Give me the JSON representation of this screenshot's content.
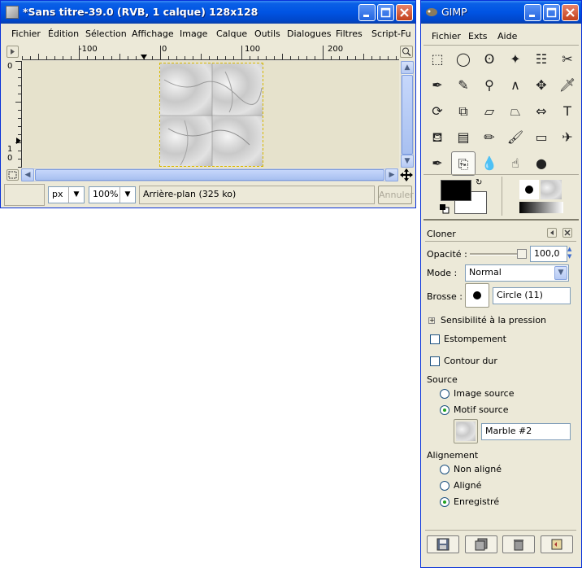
{
  "image_window": {
    "title": "*Sans titre-39.0 (RVB, 1 calque) 128x128",
    "menu": [
      "Fichier",
      "Édition",
      "Sélection",
      "Affichage",
      "Image",
      "Calque",
      "Outils",
      "Dialogues",
      "Filtres",
      "Script-Fu"
    ],
    "ruler_labels": [
      "-100",
      "0",
      "100",
      "200"
    ],
    "vruler_labels": [
      "0",
      "1",
      "0"
    ],
    "unit": "px",
    "zoom": "100%",
    "status": "Arrière-plan (325 ko)",
    "cancel_label": "Annuler"
  },
  "toolbox": {
    "title": "GIMP",
    "menu": [
      "Fichier",
      "Exts",
      "Aide"
    ],
    "tools": [
      [
        "rect-select-icon",
        "ellipse-select-icon",
        "lasso-icon",
        "magic-wand-icon",
        "color-select-icon",
        "scissors-icon"
      ],
      [
        "paths-icon",
        "color-picker-icon",
        "zoom-icon",
        "measure-icon",
        "move-icon",
        "crop-icon"
      ],
      [
        "rotate-icon",
        "scale-icon",
        "shear-icon",
        "perspective-icon",
        "flip-icon",
        "text-icon"
      ],
      [
        "bucket-fill-icon",
        "gradient-icon",
        "pencil-icon",
        "paintbrush-icon",
        "eraser-icon",
        "airbrush-icon"
      ],
      [
        "ink-icon",
        "clone-icon",
        "blur-icon",
        "smudge-icon",
        "dodge-burn-icon"
      ]
    ],
    "tool_glyphs": [
      [
        "⬚",
        "◯",
        "ʘ",
        "✦",
        "☷",
        "✂"
      ],
      [
        "✒",
        "✎",
        "⚲",
        "∧",
        "✥",
        "🗡"
      ],
      [
        "⟳",
        "⧉",
        "▱",
        "⏢",
        "⇔",
        "T"
      ],
      [
        "⛾",
        "▤",
        "✏",
        "🖌",
        "▭",
        "✈"
      ],
      [
        "✒",
        "⎘",
        "💧",
        "☝",
        "●"
      ]
    ]
  },
  "tool_options": {
    "title": "Cloner",
    "opacity_label": "Opacité :",
    "opacity_value": "100,0",
    "opacity_fraction": 1.0,
    "mode_label": "Mode :",
    "mode_value": "Normal",
    "brush_label": "Brosse :",
    "brush_value": "Circle (11)",
    "pressure_label": "Sensibilité à la pression",
    "fade_label": "Estompement",
    "hard_edge_label": "Contour dur",
    "source_label": "Source",
    "source_options": [
      "Image source",
      "Motif source"
    ],
    "source_selected": 1,
    "pattern_value": "Marble #2",
    "alignment_label": "Alignement",
    "alignment_options": [
      "Non aligné",
      "Aligné",
      "Enregistré"
    ],
    "alignment_selected": 2
  }
}
